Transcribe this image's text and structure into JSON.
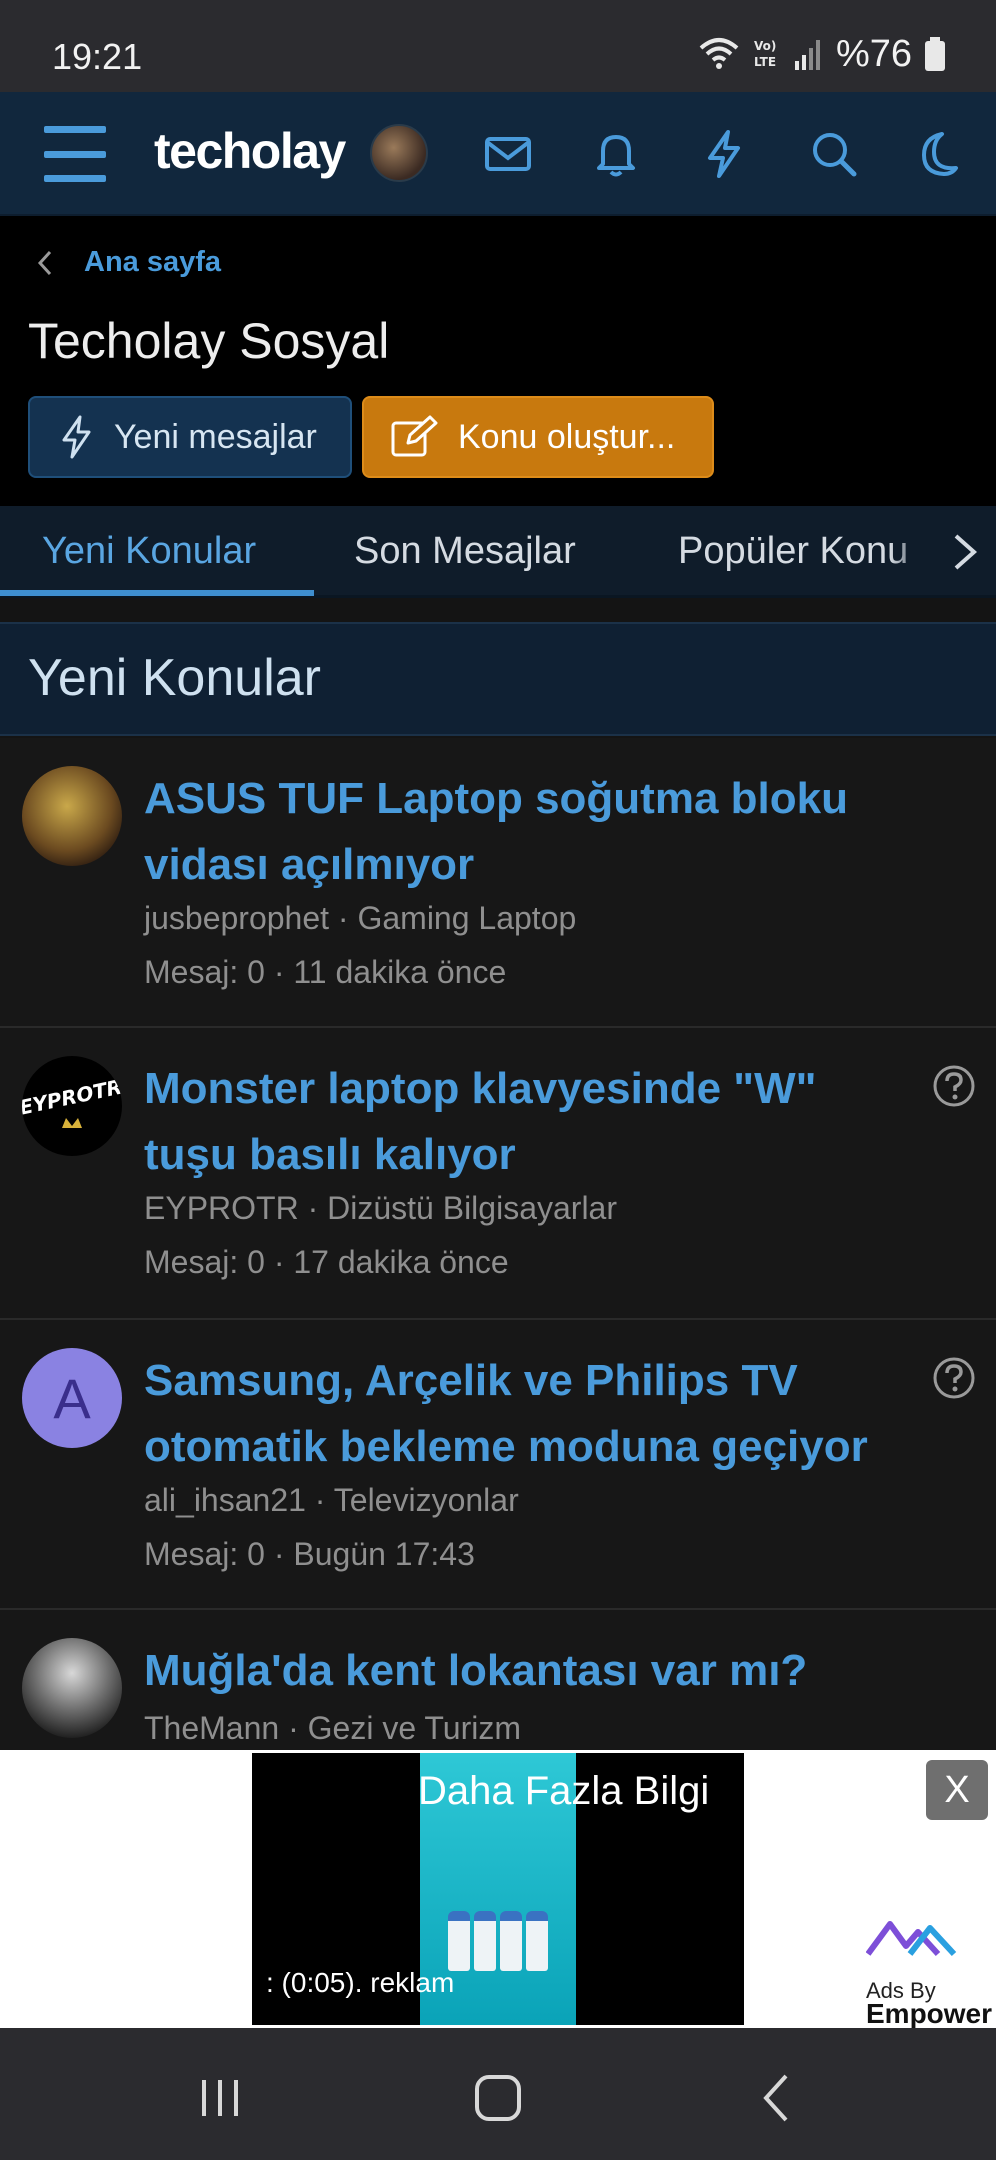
{
  "status_bar": {
    "time": "19:21",
    "battery": "%76",
    "icons": [
      "wifi-icon",
      "volte-icon",
      "signal-icon",
      "battery-icon"
    ]
  },
  "header": {
    "logo": "techolay",
    "icons": [
      "menu-icon",
      "avatar",
      "mail-icon",
      "bell-icon",
      "bolt-icon",
      "search-icon",
      "moon-icon"
    ],
    "accent_color": "#4a9bdb"
  },
  "breadcrumb": {
    "label": "Ana sayfa"
  },
  "page_title": "Techolay Sosyal",
  "buttons": {
    "new_messages": "Yeni mesajlar",
    "create_topic": "Konu oluştur..."
  },
  "tabs": [
    {
      "label": "Yeni Konular",
      "active": true
    },
    {
      "label": "Son Mesajlar",
      "active": false
    },
    {
      "label": "Popüler Konu",
      "active": false
    }
  ],
  "section_title": "Yeni Konular",
  "threads": [
    {
      "title": "ASUS TUF Laptop soğutma bloku vidası açılmıyor",
      "author": "jusbeprophet",
      "forum": "Gaming Laptop",
      "meta1": "jusbeprophet · Gaming Laptop",
      "meta2": "Mesaj: 0 · 11 dakika önce",
      "question": false
    },
    {
      "title": "Monster laptop klavyesinde \"W\" tuşu basılı kalıyor",
      "author": "EYPROTR",
      "forum": "Dizüstü Bilgisayarlar",
      "meta1": "EYPROTR · Dizüstü Bilgisayarlar",
      "meta2": "Mesaj: 0 · 17 dakika önce",
      "avatar_text": "EYPROTR",
      "question": true
    },
    {
      "title": "Samsung, Arçelik ve Philips TV otomatik bekleme moduna geçiyor",
      "author": "ali_ihsan21",
      "forum": "Televizyonlar",
      "meta1": "ali_ihsan21 · Televizyonlar",
      "meta2": "Mesaj: 0 · Bugün 17:43",
      "avatar_letter": "A",
      "question": true
    },
    {
      "title": "Muğla'da kent lokantası var mı?",
      "author": "TheMann",
      "forum": "Gezi ve Turizm",
      "meta1": "TheMann · Gezi ve Turizm",
      "question": false
    }
  ],
  "ad": {
    "more_info": "Daha Fazla Bilgi",
    "countdown": ": (0:05). reklam",
    "close": "X",
    "ads_by": "Ads By",
    "brand": "Empower"
  },
  "navbar": {
    "icons": [
      "recents-icon",
      "home-icon",
      "back-icon"
    ]
  }
}
